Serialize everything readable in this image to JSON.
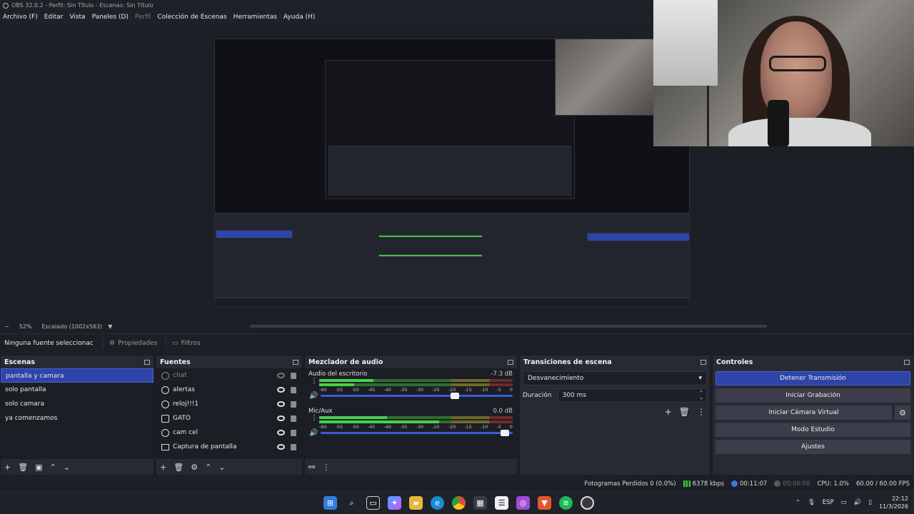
{
  "window": {
    "title": "OBS 32.0.2 - Perfil: Sin Título - Escenas: Sin Título"
  },
  "menu": [
    {
      "label": "Archivo (F)",
      "enabled": true
    },
    {
      "label": "Editar",
      "enabled": true
    },
    {
      "label": "Vista",
      "enabled": true
    },
    {
      "label": "Paneles (D)",
      "enabled": true
    },
    {
      "label": "Perfil",
      "enabled": false
    },
    {
      "label": "Colección de Escenas",
      "enabled": true
    },
    {
      "label": "Herramientas",
      "enabled": true
    },
    {
      "label": "Ayuda (H)",
      "enabled": true
    }
  ],
  "preview": {
    "zoom": "52%",
    "scaling": "Escalado (1002x563)"
  },
  "source_toolbar": {
    "no_selection": "Ninguna fuente seleccionac",
    "properties": "Propiedades",
    "filters": "Filtros"
  },
  "scenes": {
    "title": "Escenas",
    "items": [
      {
        "label": "pantalla y camara",
        "selected": true
      },
      {
        "label": "solo pantalla",
        "selected": false
      },
      {
        "label": "solo camara",
        "selected": false
      },
      {
        "label": "ya comenzamos",
        "selected": false
      }
    ]
  },
  "sources": {
    "title": "Fuentes",
    "items": [
      {
        "label": "chat",
        "icon": "browser-icon",
        "visible": false
      },
      {
        "label": "alertas",
        "icon": "browser-icon",
        "visible": true
      },
      {
        "label": "reloj!!!1",
        "icon": "browser-icon",
        "visible": true
      },
      {
        "label": "GATO",
        "icon": "camera-icon",
        "visible": true
      },
      {
        "label": "cam cel",
        "icon": "browser-icon",
        "visible": true
      },
      {
        "label": "Captura de pantalla",
        "icon": "monitor-icon",
        "visible": true
      }
    ]
  },
  "mixer": {
    "title": "Mezclador de audio",
    "ticks": [
      "-60",
      "-55",
      "-50",
      "-45",
      "-40",
      "-35",
      "-30",
      "-25",
      "-20",
      "-15",
      "-10",
      "-5",
      "0"
    ],
    "channels": [
      {
        "name": "Audio del escritorio",
        "db": "-7.3 dB",
        "level_a": 0.28,
        "level_b": 0.18,
        "volume": 0.72
      },
      {
        "name": "Mic/Aux",
        "db": "0.0 dB",
        "level_a": 0.35,
        "level_b": 0.62,
        "volume": 0.98
      }
    ]
  },
  "transitions": {
    "title": "Transiciones de escena",
    "type": "Desvanecimiento",
    "duration_label": "Duración",
    "duration_value": "300 ms"
  },
  "controls": {
    "title": "Controles",
    "stop_stream": "Detener Transmisión",
    "start_recording": "Iniciar Grabación",
    "start_virtualcam": "Iniciar Cámara Virtual",
    "studio_mode": "Modo Estudio",
    "settings": "Ajustes"
  },
  "status": {
    "dropped_frames": "Fotogramas Perdidos 0 (0.0%)",
    "bitrate": "6378 kbps",
    "stream_time": "00:11:07",
    "record_time": "00:00:00",
    "cpu": "CPU: 1.0%",
    "fps": "60.00 / 60.00 FPS"
  },
  "taskbar": {
    "lang": "ESP",
    "time": "22:12",
    "date": "11/3/2026"
  },
  "colors": {
    "accent": "#2e44a8",
    "panel": "#272a33",
    "background": "#1d1f26"
  }
}
